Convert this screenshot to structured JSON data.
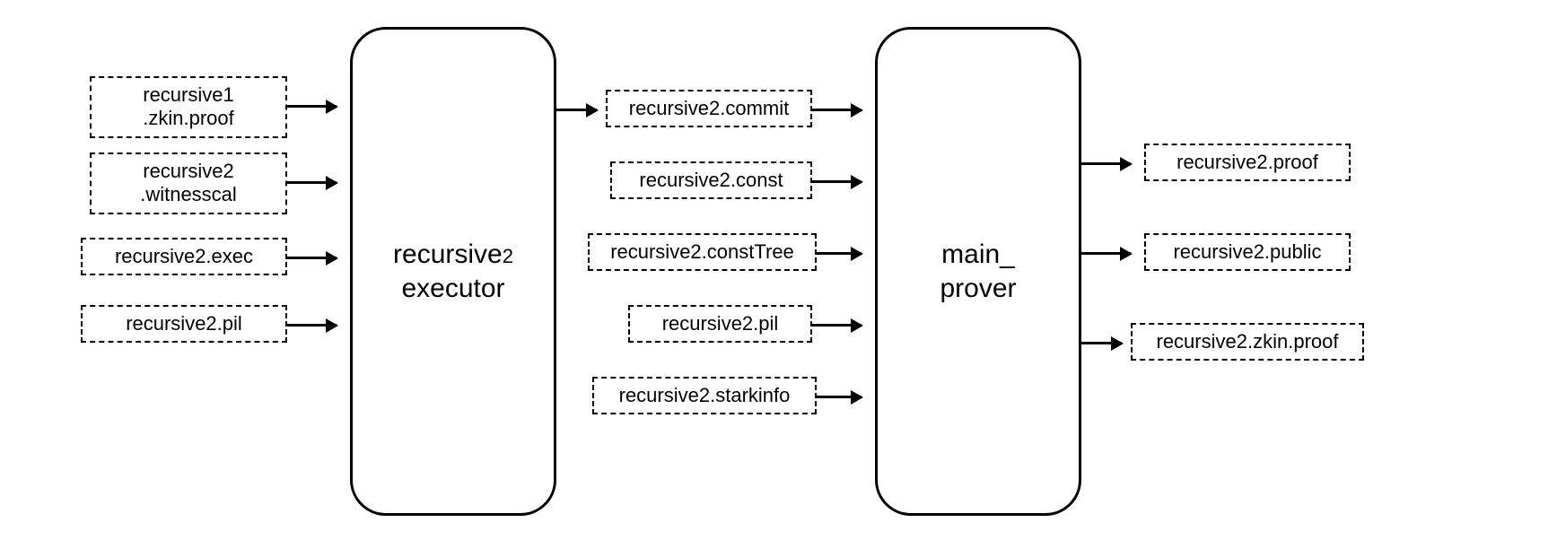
{
  "processes": {
    "executor": {
      "line1": "recursive",
      "line1_sub": "2",
      "line2": "executor"
    },
    "prover": {
      "line1": "main_",
      "line2": "prover"
    }
  },
  "inputs_left": [
    {
      "line1": "recursive1",
      "line2": ".zkin.proof"
    },
    {
      "line1": "recursive2",
      "line2": ".witnesscal"
    },
    {
      "line1": "recursive2.exec"
    },
    {
      "line1": "recursive2.pil"
    }
  ],
  "middle_files": [
    {
      "line1": "recursive2.commit"
    },
    {
      "line1": "recursive2.const"
    },
    {
      "line1": "recursive2.constTree"
    },
    {
      "line1": "recursive2.pil"
    },
    {
      "line1": "recursive2.starkinfo"
    }
  ],
  "outputs_right": [
    {
      "line1": "recursive2.proof"
    },
    {
      "line1": "recursive2.public"
    },
    {
      "line1": "recursive2.zkin.proof"
    }
  ]
}
